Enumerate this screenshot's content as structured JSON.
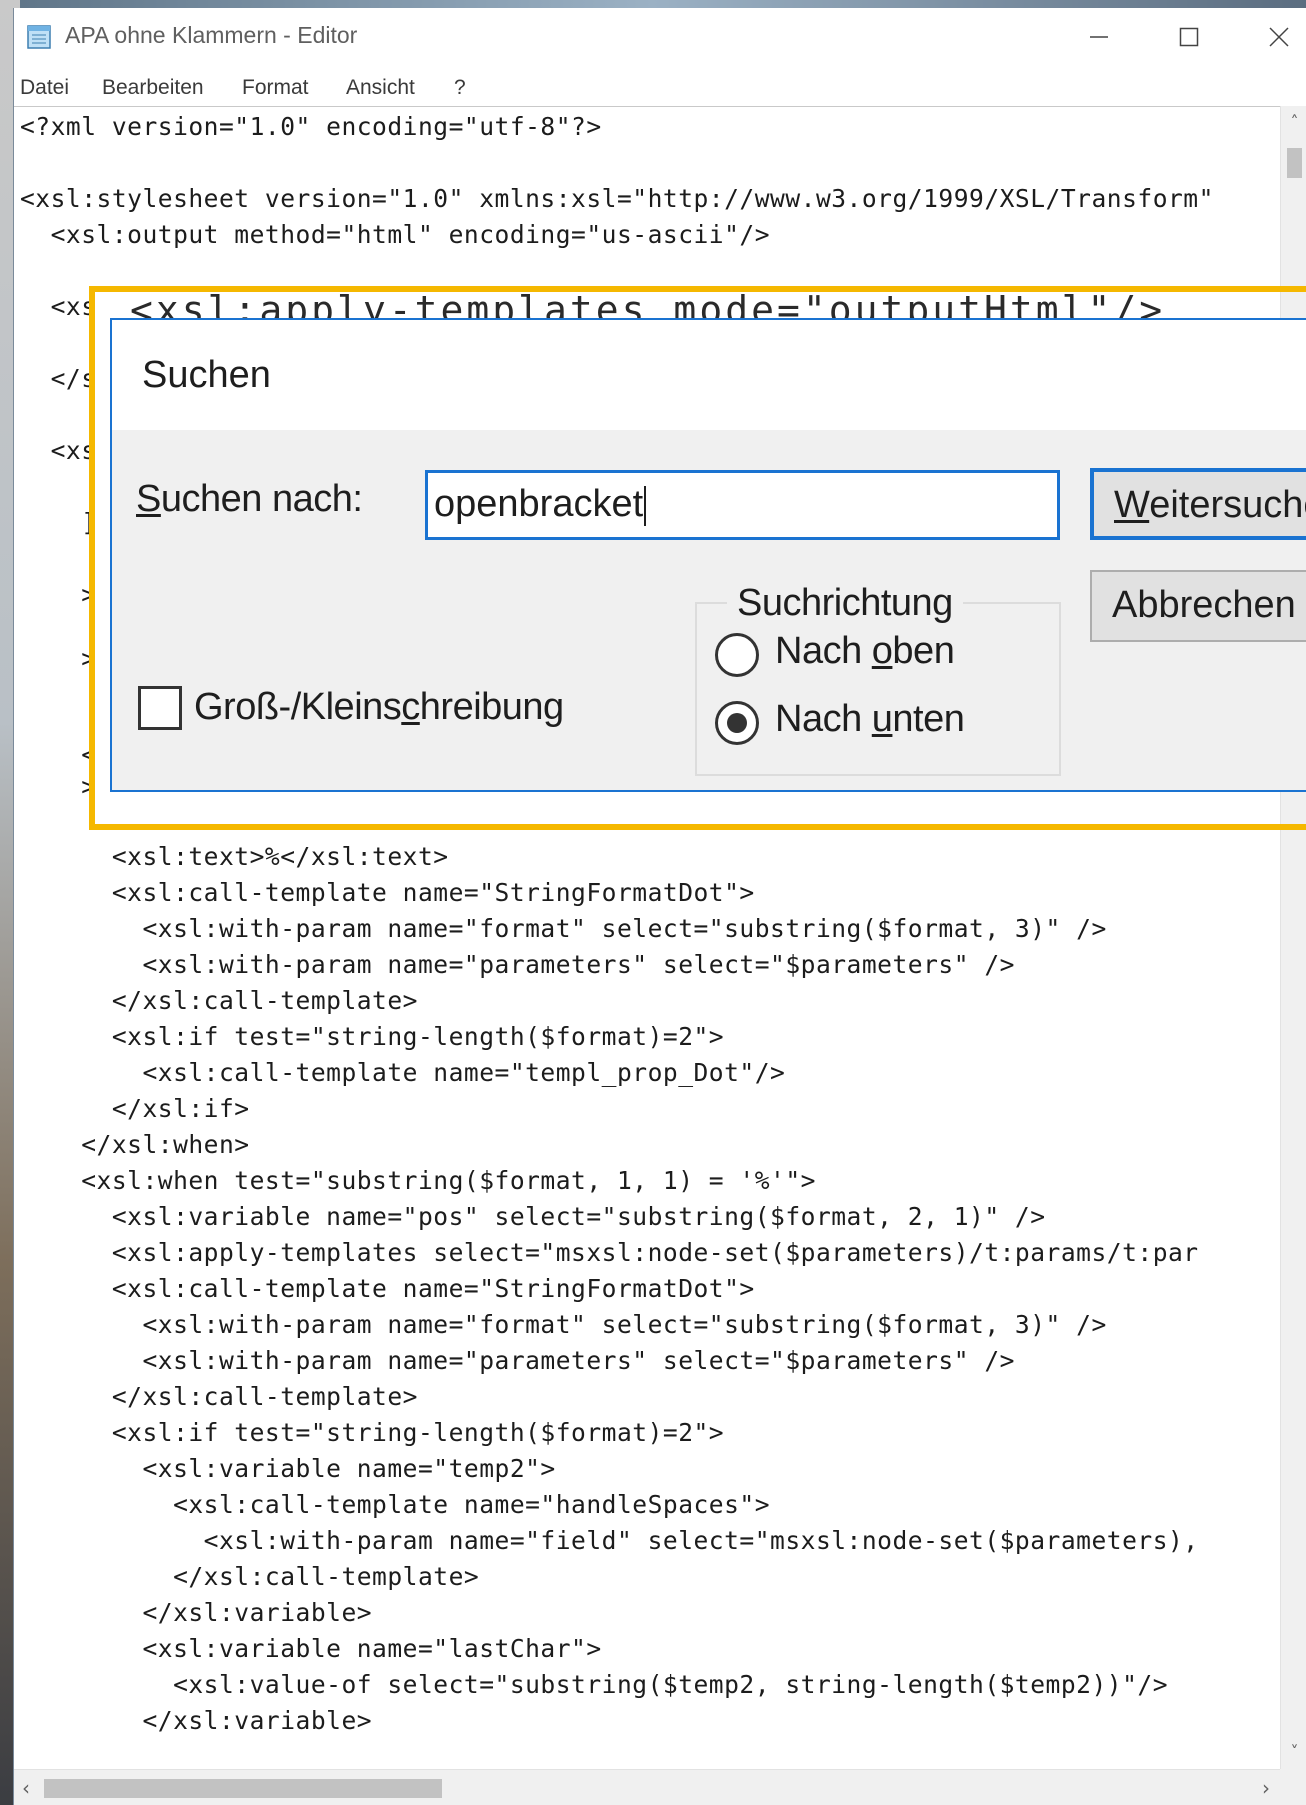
{
  "window": {
    "title": "APA ohne Klammern - Editor",
    "minimize_symbol": "—",
    "maximize_symbol": "☐",
    "close_symbol": "✕"
  },
  "menubar": {
    "items": [
      "Datei",
      "Bearbeiten",
      "Format",
      "Ansicht",
      "?"
    ]
  },
  "editor": {
    "lines_top": [
      "<?xml version=\"1.0\" encoding=\"utf-8\"?>",
      "",
      "<xsl:stylesheet version=\"1.0\" xmlns:xsl=\"http://www.w3.org/1999/XSL/Transform\"",
      "  <xsl:output method=\"html\" encoding=\"us-ascii\"/>",
      "",
      "  <xs",
      "",
      "  </s",
      "",
      "  <xs",
      "    ]",
      "",
      "    >",
      "",
      "    >",
      "",
      "    <",
      "    >"
    ],
    "lines_bottom": [
      "      <xsl:text>%</xsl:text>",
      "      <xsl:call-template name=\"StringFormatDot\">",
      "        <xsl:with-param name=\"format\" select=\"substring($format, 3)\" />",
      "        <xsl:with-param name=\"parameters\" select=\"$parameters\" />",
      "      </xsl:call-template>",
      "      <xsl:if test=\"string-length($format)=2\">",
      "        <xsl:call-template name=\"templ_prop_Dot\"/>",
      "      </xsl:if>",
      "    </xsl:when>",
      "    <xsl:when test=\"substring($format, 1, 1) = '%'\">",
      "      <xsl:variable name=\"pos\" select=\"substring($format, 2, 1)\" />",
      "      <xsl:apply-templates select=\"msxsl:node-set($parameters)/t:params/t:par",
      "      <xsl:call-template name=\"StringFormatDot\">",
      "        <xsl:with-param name=\"format\" select=\"substring($format, 3)\" />",
      "        <xsl:with-param name=\"parameters\" select=\"$parameters\" />",
      "      </xsl:call-template>",
      "      <xsl:if test=\"string-length($format)=2\">",
      "        <xsl:variable name=\"temp2\">",
      "          <xsl:call-template name=\"handleSpaces\">",
      "            <xsl:with-param name=\"field\" select=\"msxsl:node-set($parameters),",
      "          </xsl:call-template>",
      "        </xsl:variable>",
      "        <xsl:variable name=\"lastChar\">",
      "          <xsl:value-of select=\"substring($temp2, string-length($temp2))\"/>",
      "        </xsl:variable>"
    ],
    "ghost_top": "<xsl:apply-templates mode=\"outputHtml\"/>"
  },
  "find_dialog": {
    "title": "Suchen",
    "search_label_accel": "S",
    "search_label_rest": "uchen nach:",
    "search_value": "openbracket",
    "find_next_accel": "W",
    "find_next_rest": "eitersuchen",
    "cancel_label": "Abbrechen",
    "direction_label": "Suchrichtung",
    "direction_up_pre": "Nach ",
    "direction_up_accel": "o",
    "direction_up_post": "ben",
    "direction_down_pre": "Nach ",
    "direction_down_accel": "u",
    "direction_down_post": "nten",
    "direction_selected": "Nach unten",
    "match_case_pre": "Groß-/Kleins",
    "match_case_accel": "c",
    "match_case_post": "hreibung",
    "match_case_checked": false
  },
  "colors": {
    "highlight_border": "#f5b800",
    "focus_blue": "#1a73d1"
  },
  "icons": [
    "notepad-icon",
    "minimize-icon",
    "maximize-icon",
    "close-icon",
    "scroll-up-icon",
    "scroll-down-icon",
    "scroll-left-icon",
    "scroll-right-icon"
  ]
}
